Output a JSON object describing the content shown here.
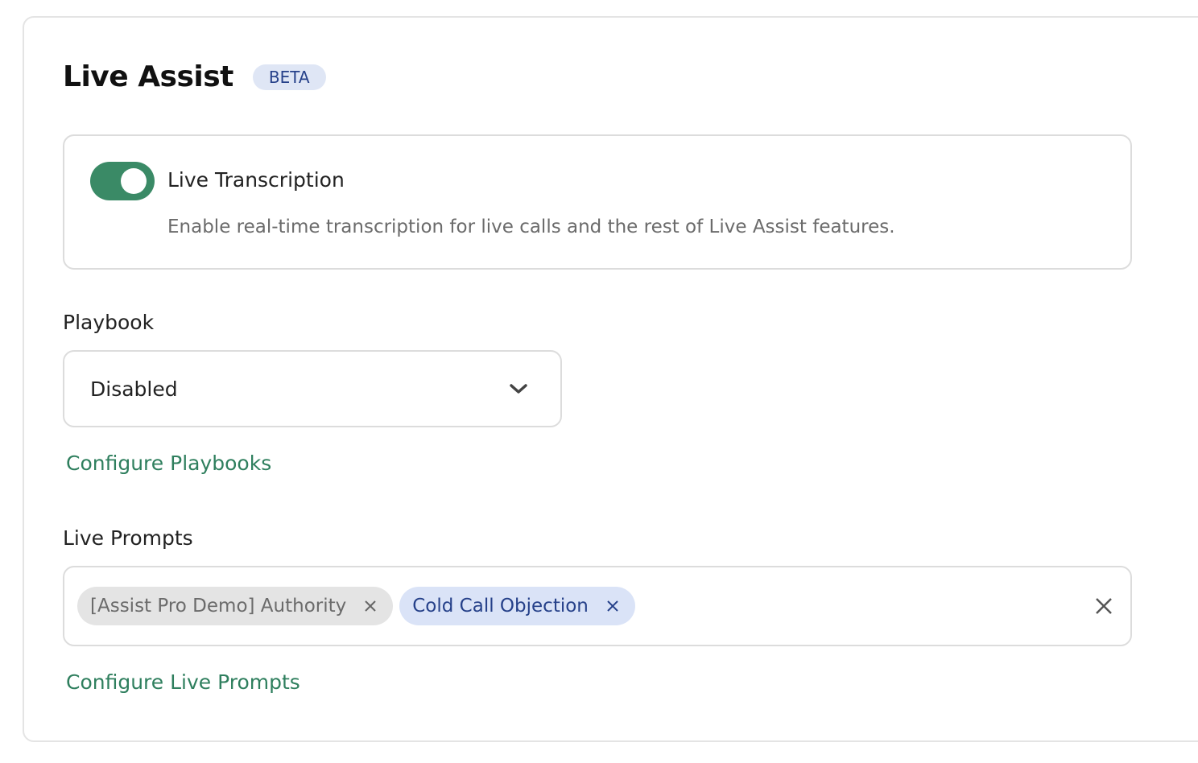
{
  "header": {
    "title": "Live Assist",
    "badge": "BETA"
  },
  "transcription": {
    "enabled": true,
    "title": "Live Transcription",
    "description": "Enable real-time transcription for live calls and the rest of Live Assist features."
  },
  "playbook": {
    "label": "Playbook",
    "selected": "Disabled",
    "configure_link": "Configure Playbooks"
  },
  "live_prompts": {
    "label": "Live Prompts",
    "chips": [
      {
        "label": "[Assist Pro Demo] Authority",
        "style": "gray"
      },
      {
        "label": "Cold Call Objection",
        "style": "blue"
      }
    ],
    "configure_link": "Configure Live Prompts"
  },
  "colors": {
    "accent": "#3a8a66",
    "link": "#2f7f5e",
    "badge_bg": "#dfe6f5",
    "badge_text": "#26418a",
    "chip_gray_bg": "#e4e4e4",
    "chip_blue_bg": "#dae3f7"
  },
  "icons": {
    "toggle": "toggle-switch",
    "select": "chevron-down-icon",
    "chip_remove": "close-icon",
    "clear_all": "close-icon"
  }
}
